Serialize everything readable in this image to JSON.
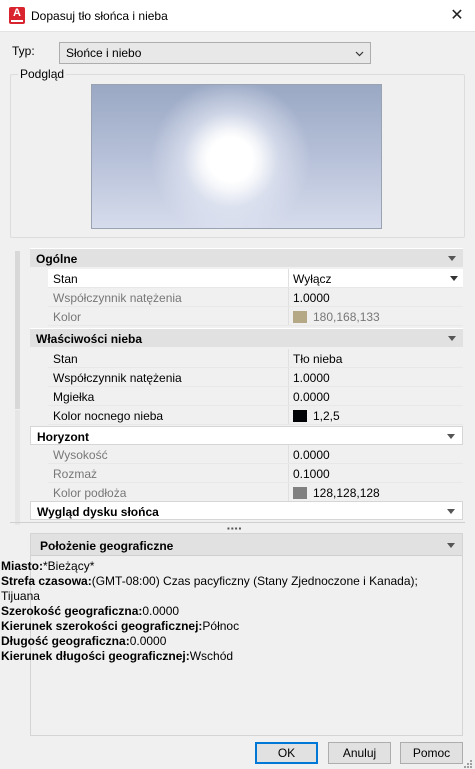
{
  "window": {
    "title": "Dopasuj tło słońca i nieba",
    "app_icon_letter": "A"
  },
  "type_field": {
    "label": "Typ:",
    "value": "Słońce i niebo"
  },
  "preview": {
    "label": "Podgląd"
  },
  "general": {
    "title": "Ogólne",
    "rows": [
      {
        "key": "Stan",
        "value": "Wyłącz"
      },
      {
        "key": "Współczynnik natężenia",
        "value": "1.0000"
      },
      {
        "key": "Kolor",
        "value": "180,168,133",
        "swatch": "#b4a885"
      }
    ]
  },
  "sky": {
    "title": "Właściwości nieba",
    "rows": [
      {
        "key": "Stan",
        "value": "Tło nieba"
      },
      {
        "key": "Współczynnik natężenia",
        "value": "1.0000"
      },
      {
        "key": "Mgiełka",
        "value": "0.0000"
      },
      {
        "key": "Kolor nocnego nieba",
        "value": "1,2,5",
        "swatch": "#010205"
      }
    ]
  },
  "horizon": {
    "title": "Horyzont",
    "rows": [
      {
        "key": "Wysokość",
        "value": "0.0000"
      },
      {
        "key": "Rozmaż",
        "value": "0.1000"
      },
      {
        "key": "Kolor podłoża",
        "value": "128,128,128",
        "swatch": "#808080"
      }
    ]
  },
  "sundisk": {
    "title": "Wygląd dysku słońca"
  },
  "geo": {
    "title": "Położenie geograficzne",
    "city_label": "Miasto:",
    "city_value": "*Bieżący*",
    "tz_label": "Strefa czasowa:",
    "tz_value": "(GMT-08:00) Czas pacyficzny (Stany Zjednoczone i Kanada);",
    "tz_value2": "Tijuana",
    "lat_label": "Szerokość geograficzna:",
    "lat_value": "0.0000",
    "latdir_label": "Kierunek szerokości geograficznej:",
    "latdir_value": "Północ",
    "lon_label": "Długość geograficzna:",
    "lon_value": "0.0000",
    "londir_label": "Kierunek długości geograficznej:",
    "londir_value": "Wschód"
  },
  "buttons": {
    "ok": "OK",
    "cancel": "Anuluj",
    "help": "Pomoc"
  }
}
